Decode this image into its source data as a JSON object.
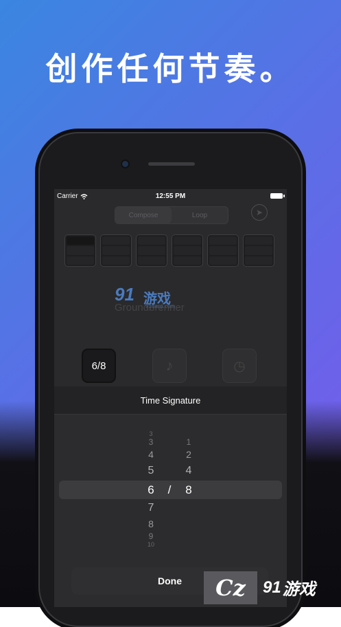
{
  "headline": "创作任何节奏。",
  "status_bar": {
    "carrier": "Carrier",
    "time": "12:55 PM"
  },
  "segmented": {
    "compose": "Compose",
    "loop": "Loop"
  },
  "watermark_logo": {
    "number": "91",
    "text": "游戏",
    "domain": "91danji.com"
  },
  "composer_text": "Groundbrenner",
  "toolbar": {
    "time_signature_button": "6/8",
    "music_icon": "♪",
    "clock_icon": "◷"
  },
  "sheet": {
    "title": "Time Signature",
    "numerators": [
      "3",
      "4",
      "5",
      "6",
      "7",
      "8",
      "9",
      "10"
    ],
    "denominators": [
      "1",
      "2",
      "4",
      "8"
    ],
    "selected_numerator": "6",
    "selected_denominator": "8",
    "separator": "/",
    "done_label": "Done"
  },
  "corner_watermark": {
    "number": "91",
    "text": "游戏"
  }
}
